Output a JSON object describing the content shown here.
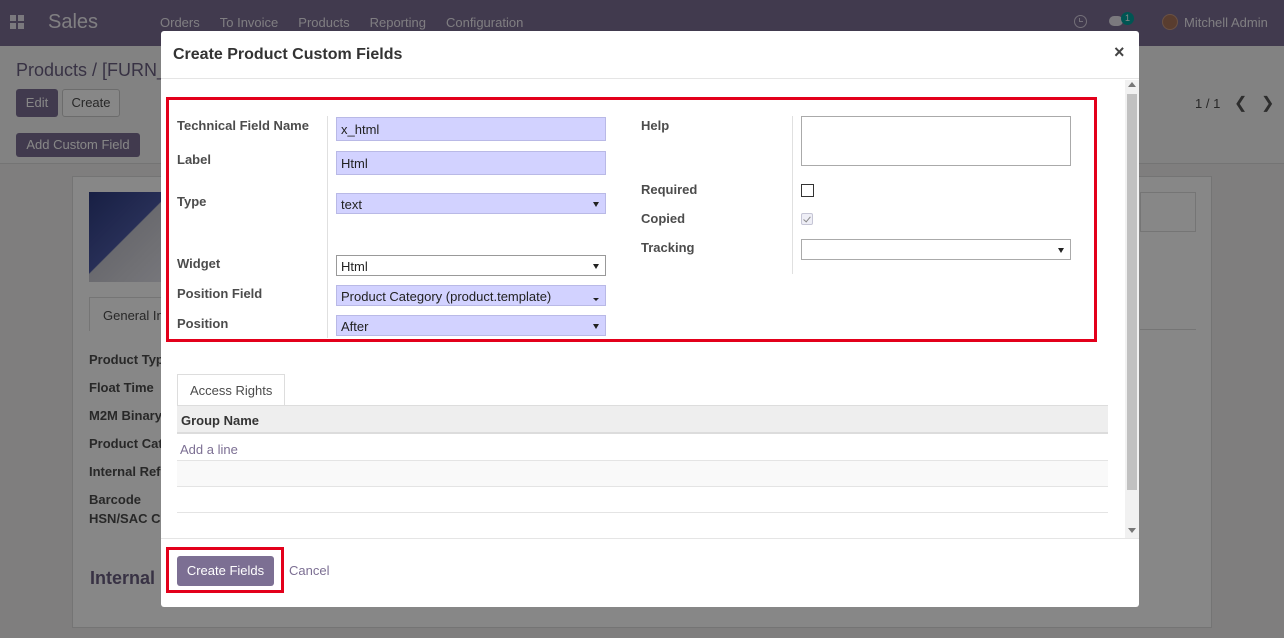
{
  "navbar": {
    "app_name": "Sales",
    "menu": [
      "Orders",
      "To Invoice",
      "Products",
      "Reporting",
      "Configuration"
    ],
    "chat_count": "1",
    "user_name": "Mitchell Admin"
  },
  "background": {
    "breadcrumb": "Products / [FURN_",
    "edit_label": "Edit",
    "create_label": "Create",
    "pager": "1 / 1",
    "add_custom_field_label": "Add Custom Field",
    "general_tab": "General In",
    "fields": [
      "Product Typ",
      "Float Time",
      "M2M Binary",
      "Product Cat",
      "Internal Ref",
      "Barcode",
      "HSN/SAC C"
    ],
    "section_title": "Internal"
  },
  "modal": {
    "title": "Create Product Custom Fields",
    "form": {
      "technical_field_name_label": "Technical Field Name",
      "technical_field_name_value": "x_html",
      "label_label": "Label",
      "label_value": "Html",
      "type_label": "Type",
      "type_value": "text",
      "widget_label": "Widget",
      "widget_value": "Html",
      "position_field_label": "Position Field",
      "position_field_value": "Product Category (product.template)",
      "position_label": "Position",
      "position_value": "After",
      "help_label": "Help",
      "help_value": "",
      "required_label": "Required",
      "required_checked": false,
      "copied_label": "Copied",
      "copied_checked": true,
      "tracking_label": "Tracking",
      "tracking_value": ""
    },
    "tab_access_rights": "Access Rights",
    "table": {
      "header_group_name": "Group Name",
      "add_line": "Add a line"
    },
    "footer": {
      "create_fields_label": "Create Fields",
      "cancel_label": "Cancel"
    }
  },
  "colors": {
    "brand": "#7c6f93",
    "highlight": "#e3001b",
    "required_input": "#d2d2ff"
  }
}
